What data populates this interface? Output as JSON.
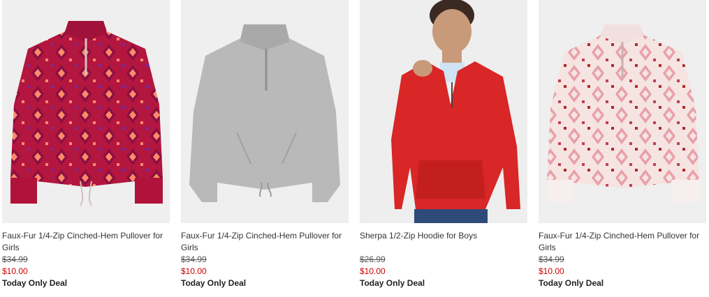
{
  "products": [
    {
      "title": "Faux-Fur 1/4-Zip Cinched-Hem Pullover for Girls",
      "original_price": "$34.99",
      "sale_price": "$10.00",
      "deal": "Today Only Deal",
      "image": "red-patterned-pullover",
      "main_color": "#b3163f"
    },
    {
      "title": "Faux-Fur 1/4-Zip Cinched-Hem Pullover for Girls",
      "original_price": "$34.99",
      "sale_price": "$10.00",
      "deal": "Today Only Deal",
      "image": "gray-pullover",
      "main_color": "#b8b8b8"
    },
    {
      "title": "Sherpa 1/2-Zip Hoodie for Boys",
      "original_price": "$26.99",
      "sale_price": "$10.00",
      "deal": "Today Only Deal",
      "image": "red-sherpa-hoodie-on-boy",
      "main_color": "#d92626"
    },
    {
      "title": "Faux-Fur 1/4-Zip Cinched-Hem Pullover for Girls",
      "original_price": "$34.99",
      "sale_price": "$10.00",
      "deal": "Today Only Deal",
      "image": "pink-patterned-pullover",
      "main_color": "#f4dcdc"
    }
  ]
}
